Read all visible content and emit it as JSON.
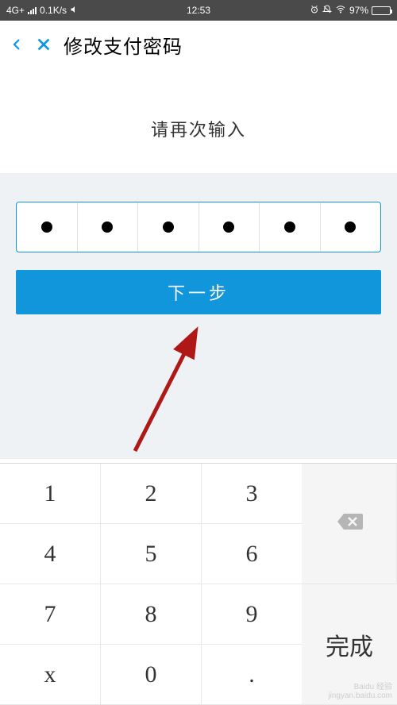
{
  "status": {
    "network": "4G+",
    "speed": "0.1K/s",
    "time": "12:53",
    "battery_pct": "97%"
  },
  "header": {
    "title": "修改支付密码"
  },
  "prompt": "请再次输入",
  "pin": {
    "length": 6,
    "filled": 6
  },
  "next_button": "下一步",
  "keypad": {
    "keys": [
      [
        "1",
        "2",
        "3"
      ],
      [
        "4",
        "5",
        "6"
      ],
      [
        "7",
        "8",
        "9"
      ],
      [
        "x",
        "0",
        "."
      ]
    ],
    "done": "完成"
  },
  "watermark": {
    "line1": "Baidu 经验",
    "line2": "jingyan.baidu.com"
  }
}
